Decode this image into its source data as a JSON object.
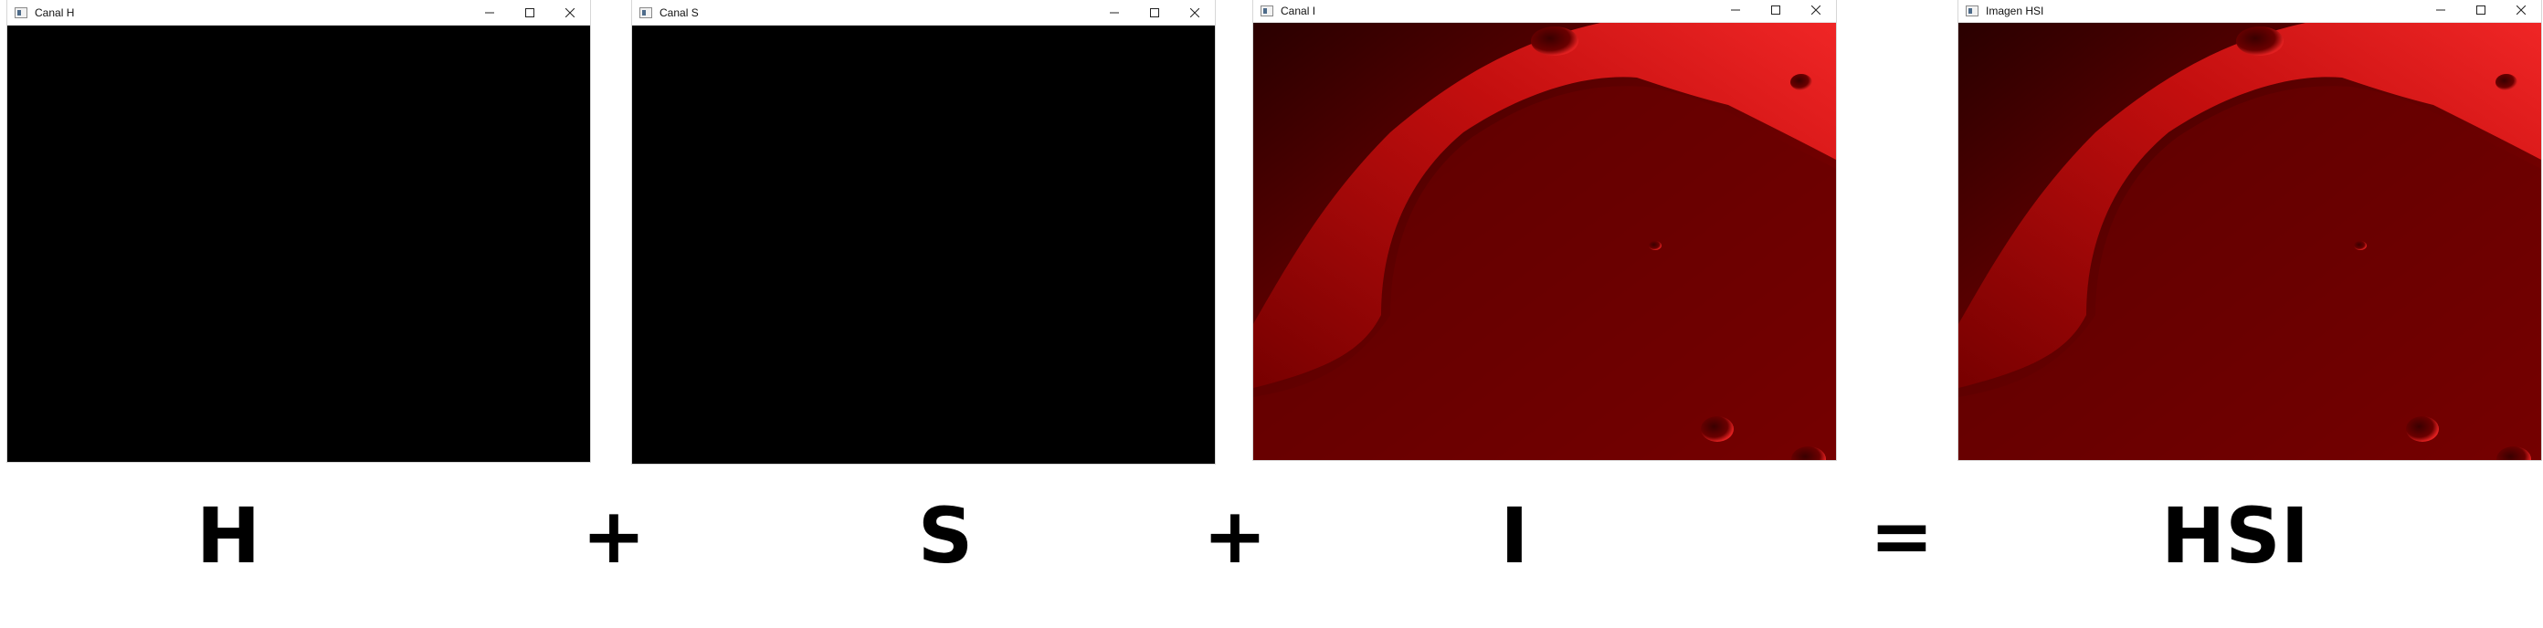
{
  "windows": [
    {
      "title": "Canal H",
      "content": "black"
    },
    {
      "title": "Canal S",
      "content": "black"
    },
    {
      "title": "Canal I",
      "content": "moon-red"
    },
    {
      "title": "Imagen HSI",
      "content": "moon-red"
    }
  ],
  "formula": {
    "h": "H",
    "plus1": "+",
    "s": "S",
    "plus2": "+",
    "i": "I",
    "equals": "=",
    "hsi": "HSI"
  },
  "colors": {
    "moon_red": "#b00000",
    "black": "#000000"
  }
}
